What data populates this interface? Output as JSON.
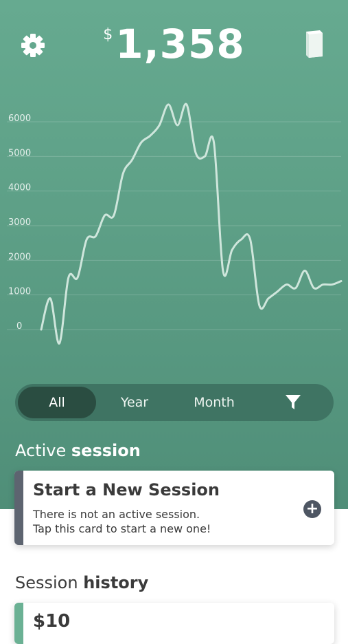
{
  "header": {
    "currency": "$",
    "balance": "1,358",
    "settings_icon": "gear-icon",
    "book_icon": "book-icon"
  },
  "chart_data": {
    "type": "line",
    "y_ticks": [
      "0",
      "1000",
      "2000",
      "3000",
      "4000",
      "5000",
      "6000"
    ],
    "ylim": [
      0,
      6000
    ],
    "grid": true,
    "x": [
      0,
      1,
      2,
      3,
      4,
      5,
      6,
      7,
      8,
      9,
      10,
      11,
      12,
      13,
      14,
      15,
      16,
      17,
      18,
      19,
      20,
      21,
      22,
      23,
      24,
      25,
      26,
      27,
      28,
      29,
      30,
      31,
      32,
      33
    ],
    "values": [
      0,
      900,
      -400,
      1500,
      1500,
      2600,
      2700,
      3300,
      3300,
      4500,
      4900,
      5400,
      5600,
      5900,
      6500,
      5900,
      6500,
      5100,
      5000,
      5400,
      1700,
      2300,
      2600,
      2600,
      700,
      900,
      1100,
      1300,
      1200,
      1700,
      1200,
      1300,
      1300,
      1400
    ],
    "line_color": "#cfe6dc"
  },
  "tabs": {
    "all": "All",
    "year": "Year",
    "month": "Month",
    "filter_icon": "filter-icon"
  },
  "active_section": {
    "prefix": "Active",
    "bold": "session"
  },
  "new_session_card": {
    "title": "Start a New Session",
    "line1": "There is not an active session.",
    "line2": "Tap this card to start a new one!",
    "plus": "+"
  },
  "history_section": {
    "prefix": "Session",
    "bold": "history"
  },
  "history_first": {
    "amount": "$10"
  }
}
